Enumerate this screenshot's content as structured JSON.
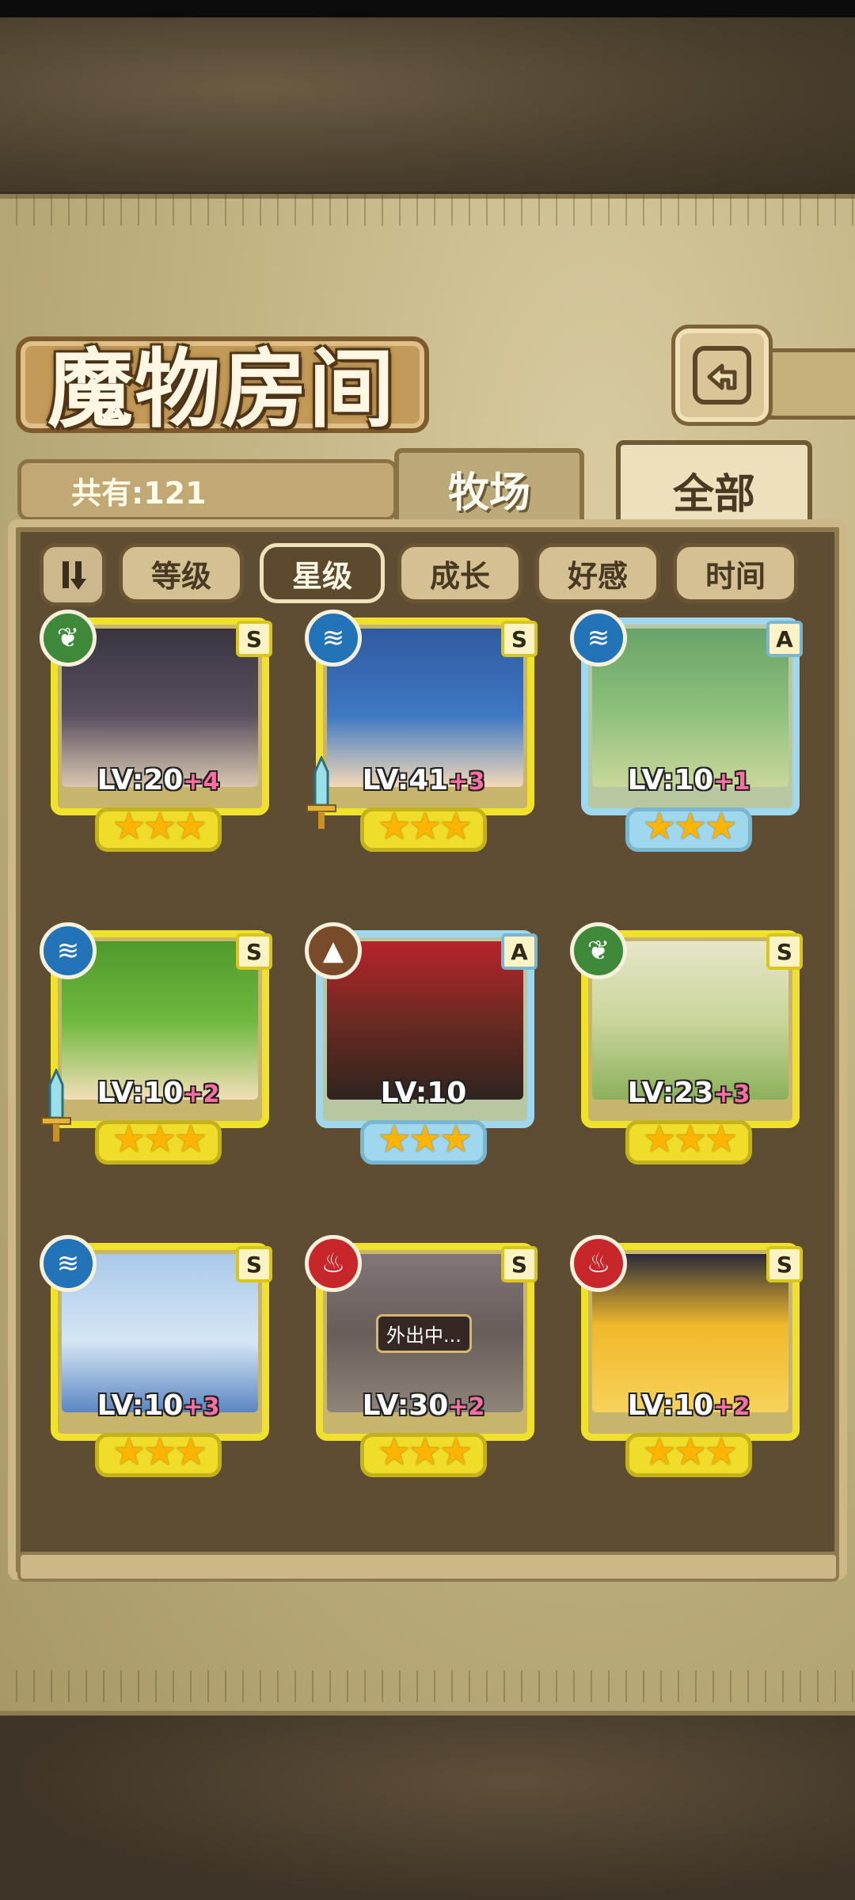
{
  "header": {
    "title": "魔物房间",
    "back_icon": "return-arrow-icon"
  },
  "summary": {
    "count_label": "共有:121"
  },
  "tabs": [
    {
      "label": "牧场",
      "active": false
    },
    {
      "label": "全部",
      "active": true
    }
  ],
  "sort": {
    "toggle_icon": "sort-order-icon",
    "buttons": [
      {
        "label": "等级",
        "active": false
      },
      {
        "label": "星级",
        "active": true
      },
      {
        "label": "成长",
        "active": false
      },
      {
        "label": "好感",
        "active": false
      },
      {
        "label": "时间",
        "active": false
      }
    ]
  },
  "monsters": [
    {
      "element": "grass",
      "rarity": "S",
      "level": "LV:20",
      "bonus": "+4",
      "stars": 3,
      "weapon": false,
      "status": ""
    },
    {
      "element": "water",
      "rarity": "S",
      "level": "LV:41",
      "bonus": "+3",
      "stars": 3,
      "weapon": true,
      "status": ""
    },
    {
      "element": "water",
      "rarity": "A",
      "level": "LV:10",
      "bonus": "+1",
      "stars": 3,
      "weapon": false,
      "status": ""
    },
    {
      "element": "water",
      "rarity": "S",
      "level": "LV:10",
      "bonus": "+2",
      "stars": 3,
      "weapon": true,
      "status": ""
    },
    {
      "element": "earth",
      "rarity": "A",
      "level": "LV:10",
      "bonus": "",
      "stars": 3,
      "weapon": false,
      "status": ""
    },
    {
      "element": "grass",
      "rarity": "S",
      "level": "LV:23",
      "bonus": "+3",
      "stars": 3,
      "weapon": false,
      "status": ""
    },
    {
      "element": "water",
      "rarity": "S",
      "level": "LV:10",
      "bonus": "+3",
      "stars": 3,
      "weapon": false,
      "status": ""
    },
    {
      "element": "fire",
      "rarity": "S",
      "level": "LV:30",
      "bonus": "+2",
      "stars": 3,
      "weapon": false,
      "status": "外出中..."
    },
    {
      "element": "fire",
      "rarity": "S",
      "level": "LV:10",
      "bonus": "+2",
      "stars": 3,
      "weapon": false,
      "status": ""
    }
  ],
  "colors": {
    "rank_s_frame": "#f0e12b",
    "rank_a_frame": "#9fd7ef",
    "grass": "#3f8a3a",
    "water": "#2373b9",
    "fire": "#c7262a",
    "earth": "#7a4b2b",
    "bonus": "#ff6ea2"
  }
}
